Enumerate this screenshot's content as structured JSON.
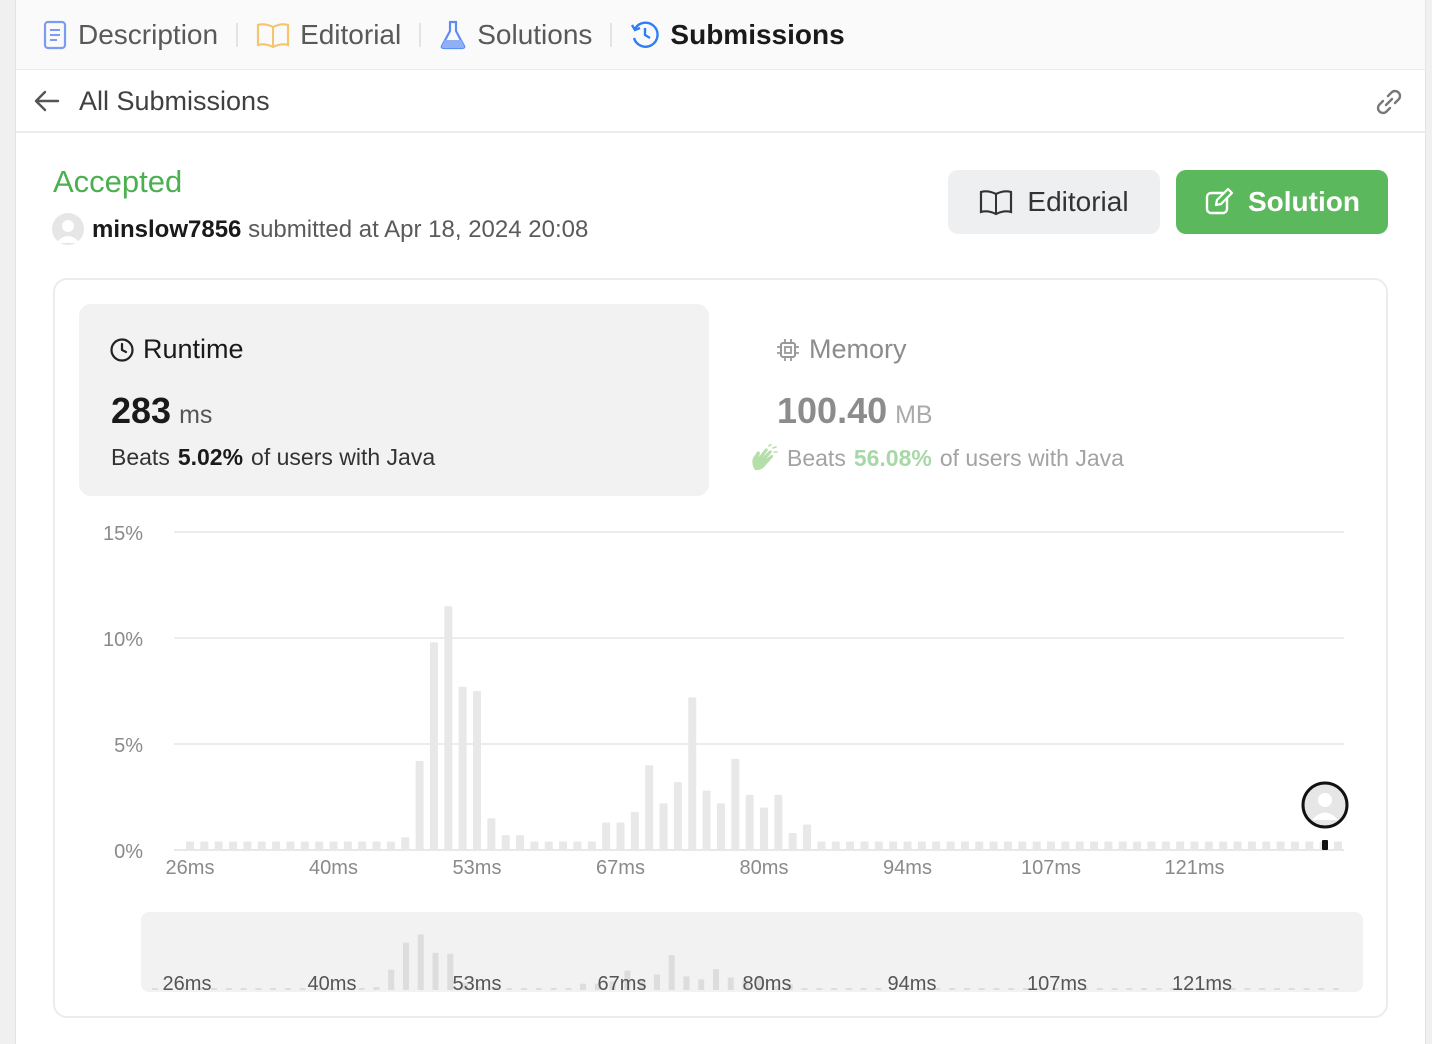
{
  "tabs": [
    {
      "label": "Description",
      "icon": "document-icon",
      "color": "#6b8ef0"
    },
    {
      "label": "Editorial",
      "icon": "book-icon",
      "color": "#f5c46b"
    },
    {
      "label": "Solutions",
      "icon": "flask-icon",
      "color": "#5b8ef5"
    },
    {
      "label": "Submissions",
      "icon": "history-icon",
      "color": "#2f7ef6",
      "active": true
    }
  ],
  "subbar": {
    "title": "All Submissions"
  },
  "submission": {
    "status": "Accepted",
    "username": "minslow7856",
    "submitted_text": "submitted at Apr 18, 2024 20:08"
  },
  "buttons": {
    "editorial": "Editorial",
    "solution": "Solution"
  },
  "runtime": {
    "label": "Runtime",
    "value": "283",
    "unit": "ms",
    "beats_prefix": "Beats",
    "beats_pct": "5.02%",
    "beats_suffix": "of users with Java"
  },
  "memory": {
    "label": "Memory",
    "value": "100.40",
    "unit": "MB",
    "beats_prefix": "Beats",
    "beats_pct": "56.08%",
    "beats_suffix": "of users with Java"
  },
  "colors": {
    "accepted": "#4caf50",
    "solution_button": "#5cb85c",
    "bar": "#e8e8e8",
    "grid": "#e6e6e6",
    "memory_pct": "#a8d8a8"
  },
  "chart_data": {
    "type": "bar",
    "title": "",
    "xlabel": "",
    "ylabel": "",
    "ylim": [
      0,
      15
    ],
    "y_ticks": [
      "15%",
      "10%",
      "5%",
      "0%"
    ],
    "x_ticks": [
      "26ms",
      "40ms",
      "53ms",
      "67ms",
      "80ms",
      "94ms",
      "107ms",
      "121ms"
    ],
    "grid": true,
    "values": [
      0.4,
      0.4,
      0.4,
      0.4,
      0.4,
      0.4,
      0.4,
      0.4,
      0.4,
      0.4,
      0.4,
      0.4,
      0.4,
      0.4,
      0.4,
      0.6,
      4.2,
      9.8,
      11.5,
      7.7,
      7.5,
      1.5,
      0.7,
      0.7,
      0.4,
      0.4,
      0.4,
      0.4,
      0.4,
      1.3,
      1.3,
      1.8,
      4.0,
      2.2,
      3.2,
      7.2,
      2.8,
      2.2,
      4.3,
      2.6,
      2.0,
      2.6,
      0.8,
      1.2,
      0.4,
      0.4,
      0.4,
      0.4,
      0.4,
      0.4,
      0.4,
      0.4,
      0.4,
      0.4,
      0.4,
      0.4,
      0.4,
      0.4,
      0.4,
      0.4,
      0.4,
      0.4,
      0.4,
      0.4,
      0.4,
      0.4,
      0.4,
      0.4,
      0.4,
      0.4,
      0.4,
      0.4,
      0.4,
      0.4,
      0.4,
      0.4,
      0.4,
      0.4,
      0.4,
      0.4,
      0.4
    ],
    "marker_value": "283ms"
  }
}
